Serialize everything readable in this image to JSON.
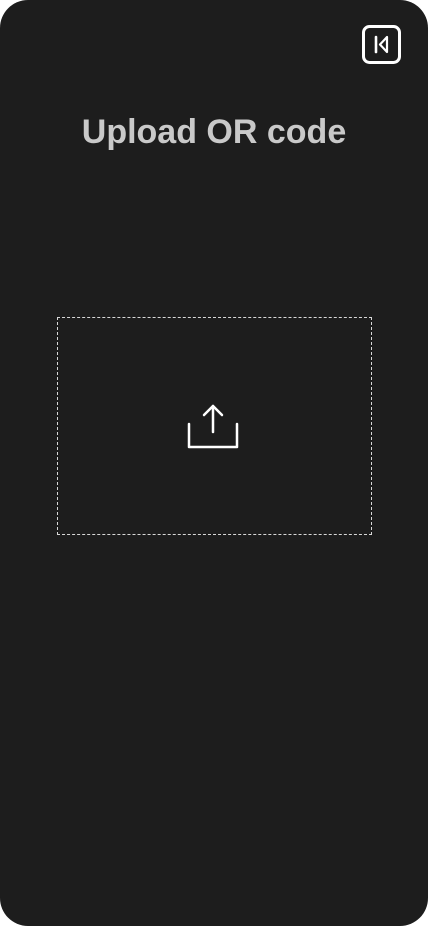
{
  "header": {
    "logo_icon": "app-logo-icon"
  },
  "main": {
    "title": "Upload OR code"
  },
  "dropzone": {
    "icon": "upload-icon"
  },
  "colors": {
    "background": "#1d1d1d",
    "title": "#c9c9c9",
    "icon": "#ffffff",
    "border": "#d8d8d8"
  }
}
